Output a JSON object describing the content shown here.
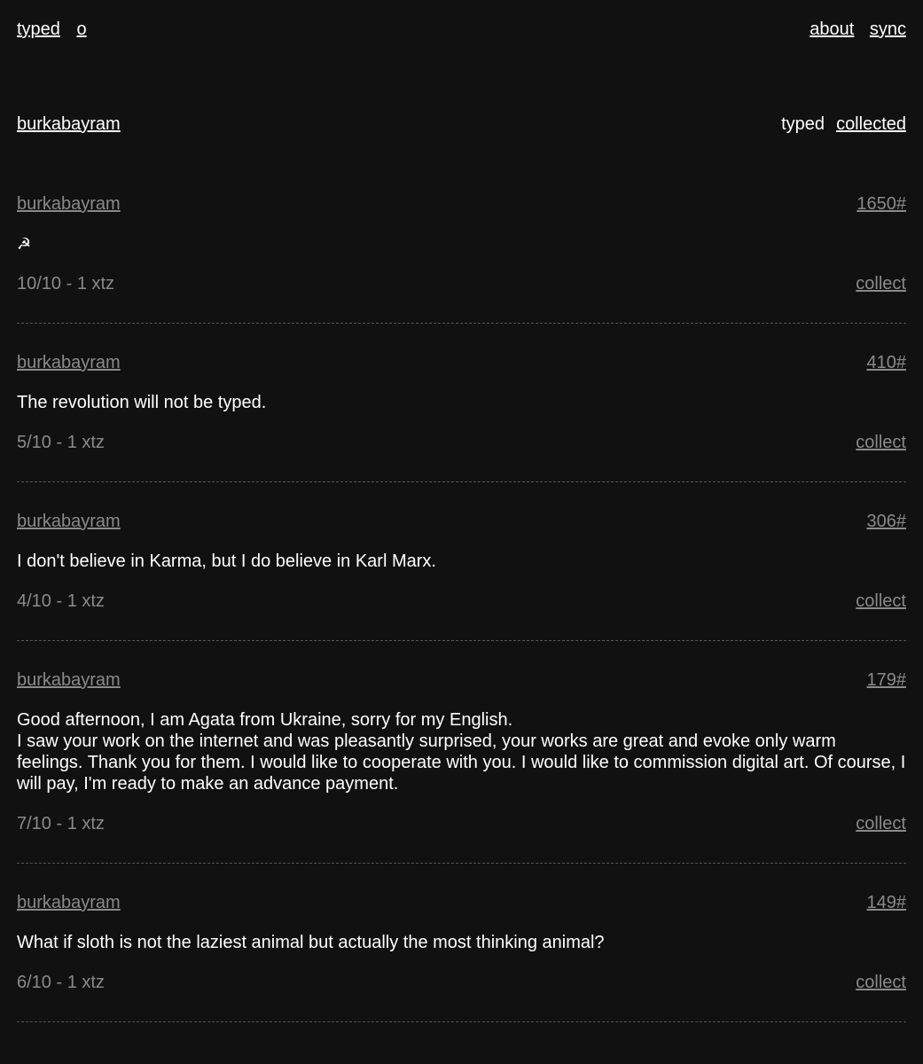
{
  "nav": {
    "left": [
      {
        "label": "typed"
      },
      {
        "label": "o"
      }
    ],
    "right": [
      {
        "label": "about"
      },
      {
        "label": "sync"
      }
    ]
  },
  "profile": {
    "name": "burkabayram",
    "tabs": {
      "typed_label": "typed",
      "collected_label": "collected"
    }
  },
  "posts": [
    {
      "author": "burkabayram",
      "id_label": "1650#",
      "text": "☭",
      "edition": "10/10 - 1 xtz",
      "action": "collect"
    },
    {
      "author": "burkabayram",
      "id_label": "410#",
      "text": "The revolution will not be typed.",
      "edition": "5/10 - 1 xtz",
      "action": "collect"
    },
    {
      "author": "burkabayram",
      "id_label": "306#",
      "text": "I don't believe in Karma, but I do believe in Karl Marx.",
      "edition": "4/10 - 1 xtz",
      "action": "collect"
    },
    {
      "author": "burkabayram",
      "id_label": "179#",
      "text": "Good afternoon, I am Agata from Ukraine, sorry for my English.\nI saw your work on the internet and was pleasantly surprised, your works are great and evoke only warm feelings. Thank you for them. I would like to cooperate with you. I would like to commission digital art. Of course, I will pay, I'm ready to make an advance payment.",
      "edition": "7/10 - 1 xtz",
      "action": "collect"
    },
    {
      "author": "burkabayram",
      "id_label": "149#",
      "text": "What if sloth is not the laziest animal but actually the most thinking animal?",
      "edition": "6/10 - 1 xtz",
      "action": "collect"
    }
  ],
  "colors": {
    "background": "#111111",
    "text": "#ffffff",
    "muted": "#8a8a8a",
    "divider": "#555555"
  }
}
